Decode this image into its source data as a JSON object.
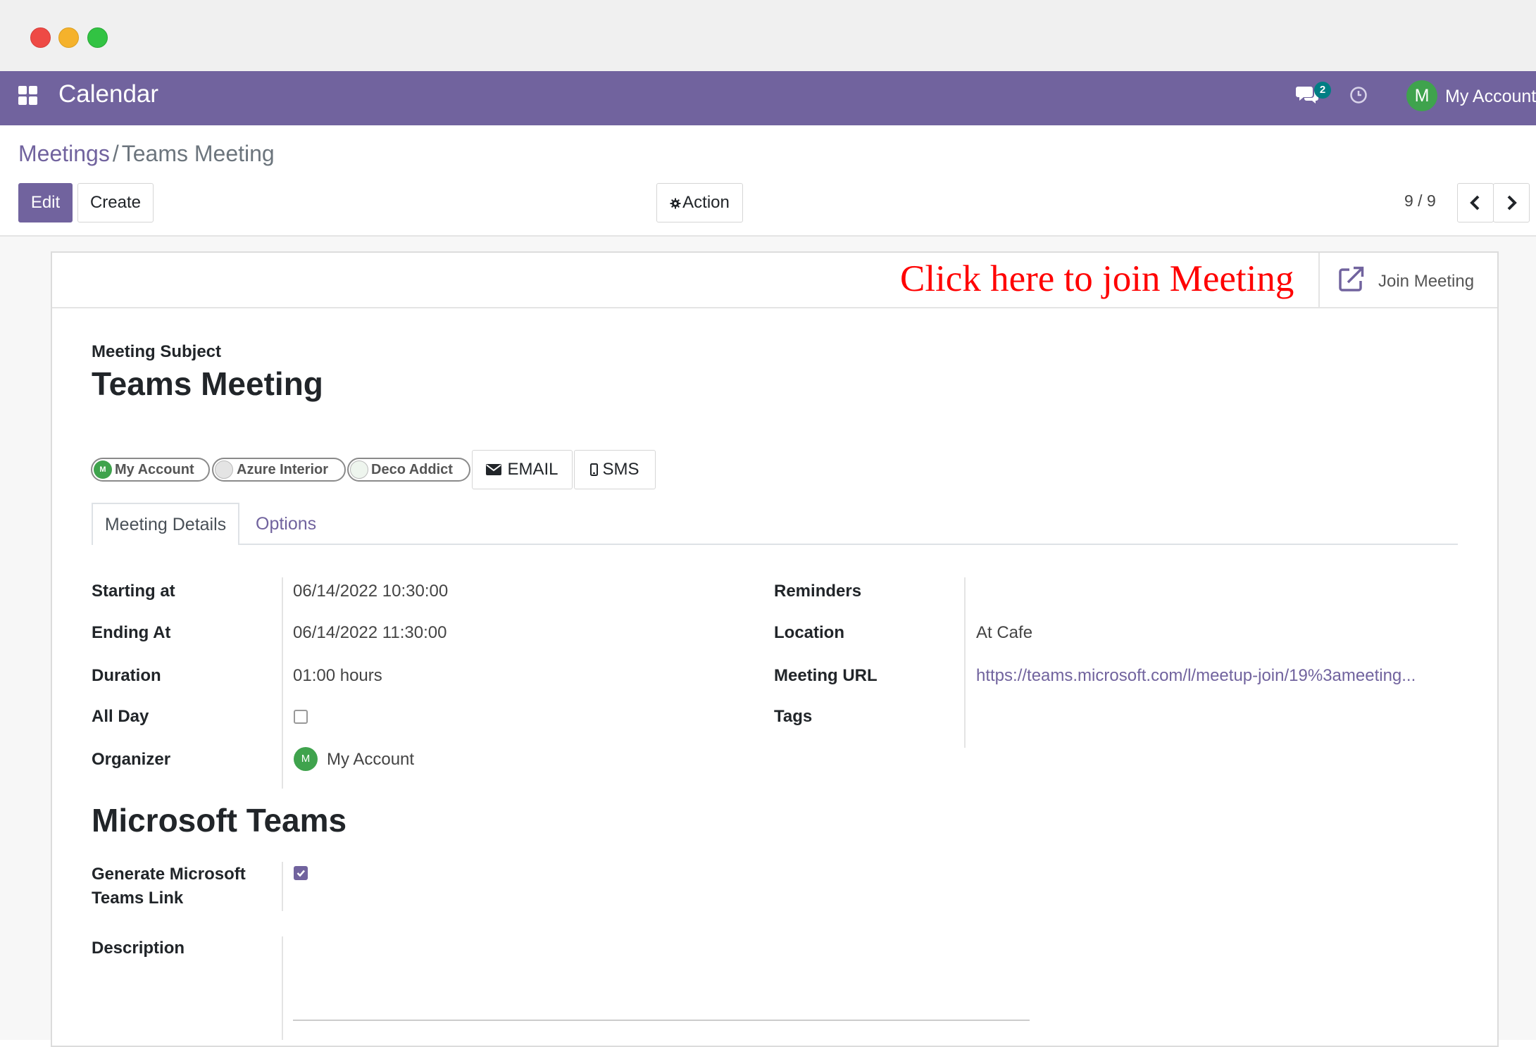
{
  "app": {
    "title": "Calendar"
  },
  "navbar": {
    "chat_count": "2",
    "avatar_initial": "M",
    "user_name": "My Account"
  },
  "breadcrumb": {
    "parent": "Meetings",
    "separator": "/",
    "current": "Teams Meeting"
  },
  "toolbar": {
    "edit_label": "Edit",
    "create_label": "Create",
    "action_label": "Action",
    "pager": "9 / 9"
  },
  "annotation": {
    "text": "Click here to join Meeting"
  },
  "statusbar": {
    "join_label": "Join Meeting"
  },
  "form": {
    "subject_label": "Meeting Subject",
    "subject_value": "Teams Meeting",
    "attendees": [
      {
        "initial": "M",
        "name": "My Account"
      },
      {
        "initial": "",
        "name": "Azure Interior"
      },
      {
        "initial": "",
        "name": "Deco Addict"
      }
    ],
    "email_label": "EMAIL",
    "sms_label": "SMS",
    "tabs": {
      "details": "Meeting Details",
      "options": "Options"
    },
    "left_fields": {
      "starting_label": "Starting at",
      "starting_value": "06/14/2022 10:30:00",
      "ending_label": "Ending At",
      "ending_value": "06/14/2022 11:30:00",
      "duration_label": "Duration",
      "duration_value": "01:00 hours",
      "allday_label": "All Day",
      "allday_checked": false,
      "organizer_label": "Organizer",
      "organizer_initial": "M",
      "organizer_value": "My Account"
    },
    "right_fields": {
      "reminders_label": "Reminders",
      "reminders_value": "",
      "location_label": "Location",
      "location_value": "At Cafe",
      "url_label": "Meeting URL",
      "url_value": "https://teams.microsoft.com/l/meetup-join/19%3ameeting...",
      "tags_label": "Tags",
      "tags_value": ""
    },
    "teams_section": {
      "title": "Microsoft Teams",
      "generate_label_line1": "Generate Microsoft",
      "generate_label_line2": "Teams Link",
      "generate_checked": true
    },
    "description_label": "Description"
  },
  "colors": {
    "brand": "#71639e",
    "annotation": "#ff0000",
    "avatar": "#3fa34d"
  }
}
